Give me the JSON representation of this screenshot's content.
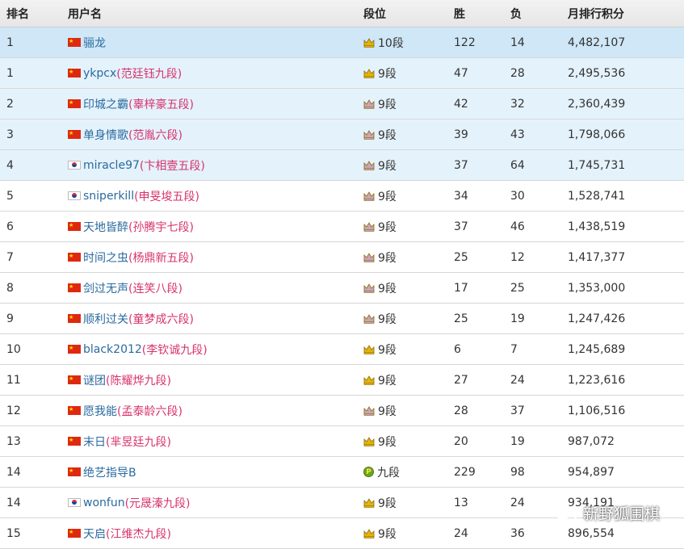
{
  "header": {
    "rank": "排名",
    "username": "用户名",
    "level": "段位",
    "wins": "胜",
    "losses": "负",
    "score": "月排行积分"
  },
  "rows": [
    {
      "rank": "1",
      "flag": "cn",
      "name": "骊龙",
      "alias": "",
      "badge": "gold-crown",
      "level": "10段",
      "wins": "122",
      "losses": "14",
      "score": "4,482,107",
      "style": "top"
    },
    {
      "rank": "1",
      "flag": "cn",
      "name": "ykpcx",
      "alias": "(范廷钰九段)",
      "badge": "gold-crown",
      "level": "9段",
      "wins": "47",
      "losses": "28",
      "score": "2,495,536",
      "style": "hl"
    },
    {
      "rank": "2",
      "flag": "cn",
      "name": "印城之霸",
      "alias": "(辜梓豪五段)",
      "badge": "silver-crown",
      "level": "9段",
      "wins": "42",
      "losses": "32",
      "score": "2,360,439",
      "style": "hl"
    },
    {
      "rank": "3",
      "flag": "cn",
      "name": "单身情歌",
      "alias": "(范胤六段)",
      "badge": "silver-crown",
      "level": "9段",
      "wins": "39",
      "losses": "43",
      "score": "1,798,066",
      "style": "hl"
    },
    {
      "rank": "4",
      "flag": "kr",
      "name": "miracle97",
      "alias": "(卞相壹五段)",
      "badge": "silver-crown",
      "level": "9段",
      "wins": "37",
      "losses": "64",
      "score": "1,745,731",
      "style": "hl"
    },
    {
      "rank": "5",
      "flag": "kr",
      "name": "sniperkill",
      "alias": "(申旻埈五段)",
      "badge": "silver-crown",
      "level": "9段",
      "wins": "34",
      "losses": "30",
      "score": "1,528,741",
      "style": ""
    },
    {
      "rank": "6",
      "flag": "cn",
      "name": "天地皆醉",
      "alias": "(孙腾宇七段)",
      "badge": "silver-crown",
      "level": "9段",
      "wins": "37",
      "losses": "46",
      "score": "1,438,519",
      "style": ""
    },
    {
      "rank": "7",
      "flag": "cn",
      "name": "时间之虫",
      "alias": "(杨鼎新五段)",
      "badge": "silver-crown",
      "level": "9段",
      "wins": "25",
      "losses": "12",
      "score": "1,417,377",
      "style": ""
    },
    {
      "rank": "8",
      "flag": "cn",
      "name": "剑过无声",
      "alias": "(连笑八段)",
      "badge": "silver-crown",
      "level": "9段",
      "wins": "17",
      "losses": "25",
      "score": "1,353,000",
      "style": ""
    },
    {
      "rank": "9",
      "flag": "cn",
      "name": "顺利过关",
      "alias": "(童梦成六段)",
      "badge": "silver-crown",
      "level": "9段",
      "wins": "25",
      "losses": "19",
      "score": "1,247,426",
      "style": ""
    },
    {
      "rank": "10",
      "flag": "cn",
      "name": "black2012",
      "alias": "(李钦诚九段)",
      "badge": "gold-crown",
      "level": "9段",
      "wins": "6",
      "losses": "7",
      "score": "1,245,689",
      "style": ""
    },
    {
      "rank": "11",
      "flag": "cn",
      "name": "谜团",
      "alias": "(陈耀烨九段)",
      "badge": "gold-crown",
      "level": "9段",
      "wins": "27",
      "losses": "24",
      "score": "1,223,616",
      "style": ""
    },
    {
      "rank": "12",
      "flag": "cn",
      "name": "愿我能",
      "alias": "(孟泰龄六段)",
      "badge": "silver-crown",
      "level": "9段",
      "wins": "28",
      "losses": "37",
      "score": "1,106,516",
      "style": ""
    },
    {
      "rank": "13",
      "flag": "cn",
      "name": "末日",
      "alias": "(芈昱廷九段)",
      "badge": "gold-crown",
      "level": "9段",
      "wins": "20",
      "losses": "19",
      "score": "987,072",
      "style": ""
    },
    {
      "rank": "14",
      "flag": "cn",
      "name": "绝艺指导B",
      "alias": "",
      "badge": "p-badge",
      "level": "九段",
      "wins": "229",
      "losses": "98",
      "score": "954,897",
      "style": ""
    },
    {
      "rank": "14",
      "flag": "kr",
      "name": "wonfun",
      "alias": "(元晟溱九段)",
      "badge": "gold-crown",
      "level": "9段",
      "wins": "13",
      "losses": "24",
      "score": "934,191",
      "style": ""
    },
    {
      "rank": "15",
      "flag": "cn",
      "name": "天启",
      "alias": "(江维杰九段)",
      "badge": "gold-crown",
      "level": "9段",
      "wins": "24",
      "losses": "36",
      "score": "896,554",
      "style": ""
    }
  ],
  "watermark": {
    "text": "新野狐围棋",
    "icon": "wechat-icon"
  },
  "colors": {
    "username": "#2a6a9e",
    "alias": "#d8336d",
    "highlight_row": "#e4f2fb",
    "top_row": "#cfe7f7",
    "gold": "#e3b313",
    "silver": "#c9a4c0"
  }
}
